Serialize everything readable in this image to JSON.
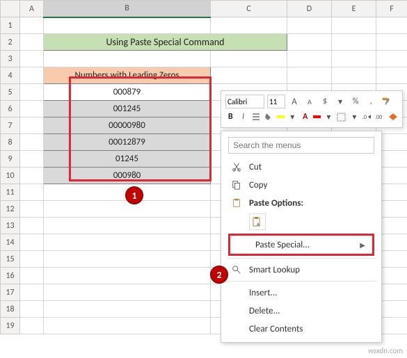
{
  "columns": [
    "A",
    "B",
    "C",
    "D",
    "E",
    "F"
  ],
  "rows": [
    "1",
    "2",
    "3",
    "4",
    "5",
    "6",
    "7",
    "8",
    "9",
    "10",
    "11",
    "12",
    "13",
    "14",
    "15",
    "16",
    "17",
    "18",
    "19"
  ],
  "title": "Using Paste Special Command",
  "table_header": "Numbers with Leading Zeros",
  "data": [
    "000879",
    "001245",
    "00000980",
    "00012879",
    "01245",
    "000980"
  ],
  "callouts": {
    "one": "1",
    "two": "2"
  },
  "mini_toolbar": {
    "font_name": "Calibri",
    "font_size": "11",
    "inc_font": "A",
    "dec_font": "A",
    "currency": "$",
    "percent": "%",
    "comma": ",",
    "bold": "B",
    "italic": "I"
  },
  "context_menu": {
    "search_placeholder": "Search the menus",
    "cut": "Cut",
    "copy": "Copy",
    "paste_options": "Paste Options:",
    "paste_special": "Paste Special...",
    "smart_lookup": "Smart Lookup",
    "insert": "Insert...",
    "delete": "Delete...",
    "clear": "Clear Contents"
  },
  "watermark": "wsxdn.com",
  "chart_data": {
    "type": "table",
    "title": "Numbers with Leading Zeros",
    "categories": [
      "Row 5",
      "Row 6",
      "Row 7",
      "Row 8",
      "Row 9",
      "Row 10"
    ],
    "values": [
      "000879",
      "001245",
      "00000980",
      "00012879",
      "01245",
      "000980"
    ]
  }
}
